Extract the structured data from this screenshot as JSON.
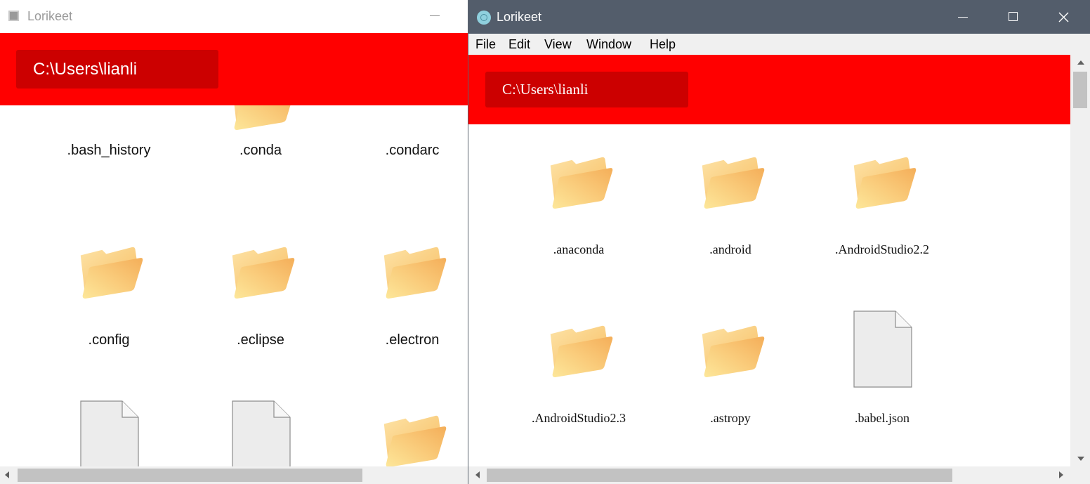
{
  "left_window": {
    "title": "Lorikeet",
    "path": "C:\\Users\\lianli",
    "items": [
      {
        "name": ".bash_history",
        "type": "file"
      },
      {
        "name": ".conda",
        "type": "folder"
      },
      {
        "name": ".condarc",
        "type": "file"
      },
      {
        "name": ".config",
        "type": "folder"
      },
      {
        "name": ".eclipse",
        "type": "folder"
      },
      {
        "name": ".electron",
        "type": "folder"
      },
      {
        "name": "",
        "type": "file"
      },
      {
        "name": "",
        "type": "file"
      },
      {
        "name": "",
        "type": "folder"
      }
    ]
  },
  "right_window": {
    "title": "Lorikeet",
    "menu": [
      "File",
      "Edit",
      "View",
      "Window",
      "Help"
    ],
    "path": "C:\\Users\\lianli",
    "items": [
      {
        "name": ".anaconda",
        "type": "folder"
      },
      {
        "name": ".android",
        "type": "folder"
      },
      {
        "name": ".AndroidStudio2.2",
        "type": "folder"
      },
      {
        "name": ".AndroidStudio2.3",
        "type": "folder"
      },
      {
        "name": ".astropy",
        "type": "folder"
      },
      {
        "name": ".babel.json",
        "type": "file"
      }
    ]
  },
  "icons": {
    "folder": "folder-icon",
    "file": "file-icon"
  },
  "colors": {
    "header_red": "#ff0000",
    "path_box_red": "#cc0000",
    "titlebar_dark": "#535d6b"
  }
}
